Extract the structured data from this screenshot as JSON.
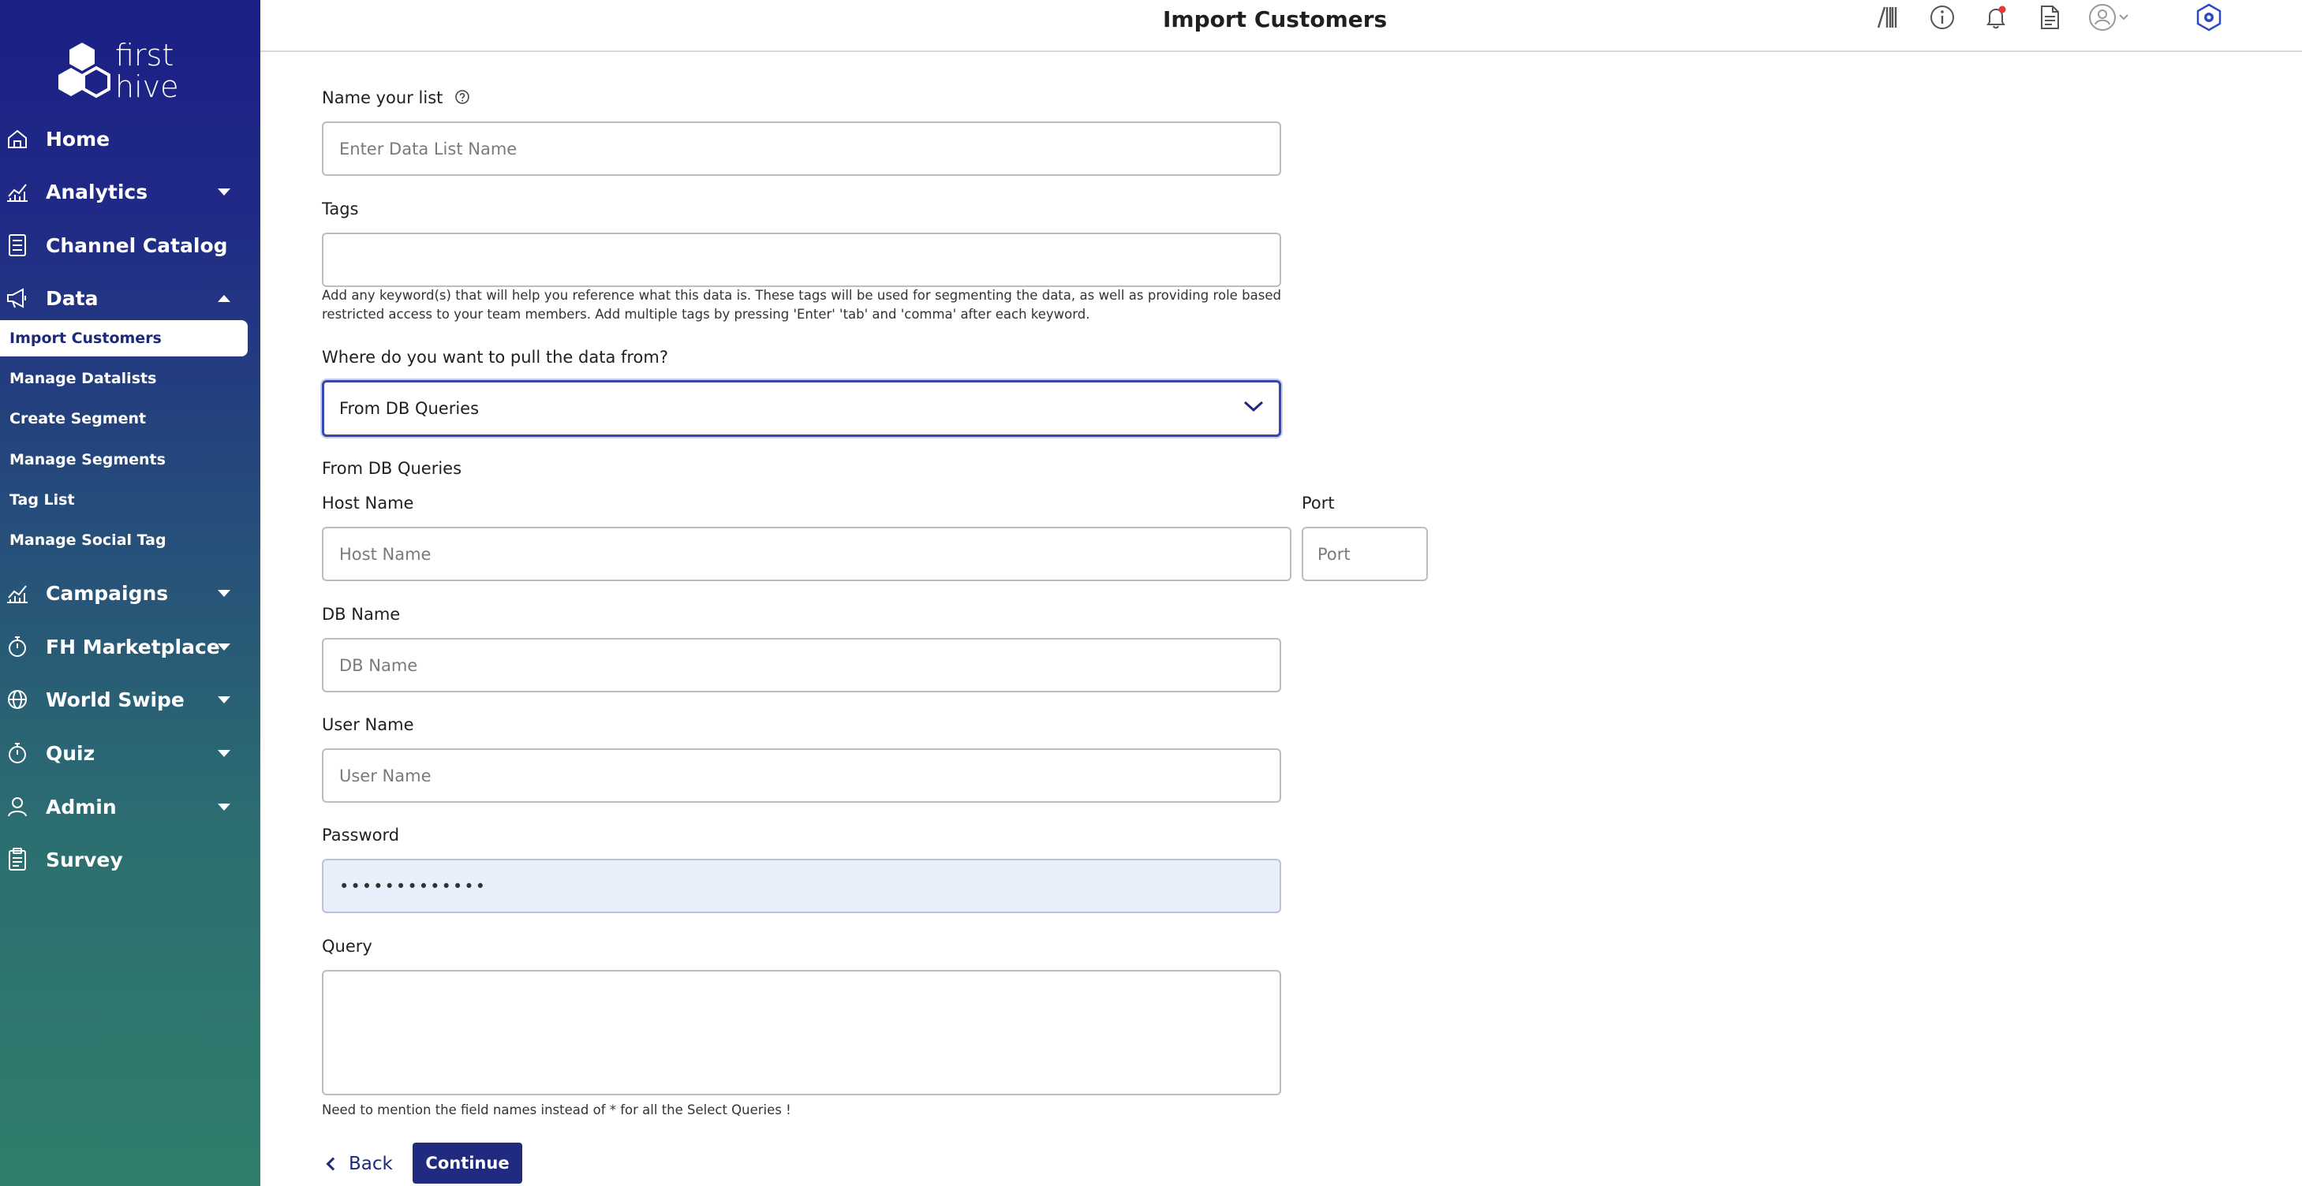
{
  "app": {
    "logo_text_line1": "first",
    "logo_text_line2": "hive",
    "page_title": "Import Customers"
  },
  "sidebar": {
    "items": [
      {
        "label": "Home",
        "icon": "home-icon"
      },
      {
        "label": "Analytics",
        "icon": "analytics-icon"
      },
      {
        "label": "Channel Catalog",
        "icon": "catalog-icon"
      },
      {
        "label": "Data",
        "icon": "megaphone-icon"
      },
      {
        "label": "Campaigns",
        "icon": "chart-icon"
      },
      {
        "label": "FH Marketplace",
        "icon": "stopwatch-icon"
      },
      {
        "label": "World Swipe",
        "icon": "globe-icon"
      },
      {
        "label": "Quiz",
        "icon": "stopwatch-icon"
      },
      {
        "label": "Admin",
        "icon": "user-icon"
      },
      {
        "label": "Survey",
        "icon": "clipboard-icon"
      }
    ],
    "data_subitems": [
      {
        "label": "Import Customers",
        "active": true
      },
      {
        "label": "Manage Datalists"
      },
      {
        "label": "Create Segment"
      },
      {
        "label": "Manage Segments"
      },
      {
        "label": "Tag List"
      },
      {
        "label": "Manage Social Tag"
      }
    ]
  },
  "form": {
    "list_name_label": "Name your list",
    "list_name_placeholder": "Enter Data List Name",
    "tags_label": "Tags",
    "tags_help": "Add any keyword(s) that will help you reference what this data is. These tags will be used for segmenting the data, as well as providing role based restricted access to your team members. Add multiple tags by pressing 'Enter' 'tab' and 'comma' after each keyword.",
    "source_label": "Where do you want to pull the data from?",
    "source_selected": "From DB Queries",
    "section_title": "From DB Queries",
    "host_label": "Host Name",
    "host_placeholder": "Host Name",
    "port_label": "Port",
    "port_placeholder": "Port",
    "db_label": "DB Name",
    "db_placeholder": "DB Name",
    "user_label": "User Name",
    "user_placeholder": "User Name",
    "password_label": "Password",
    "password_value": "•••••••••••••",
    "query_label": "Query",
    "query_note": "Need to mention the field names instead of * for all the Select Queries !",
    "back_label": "Back",
    "continue_label": "Continue"
  },
  "colors": {
    "sidebar_top": "#1b1f85",
    "sidebar_bottom": "#2f7e6c",
    "primary_button": "#1f2a80",
    "select_focus": "#3747b0",
    "notification_dot": "#e53935"
  }
}
